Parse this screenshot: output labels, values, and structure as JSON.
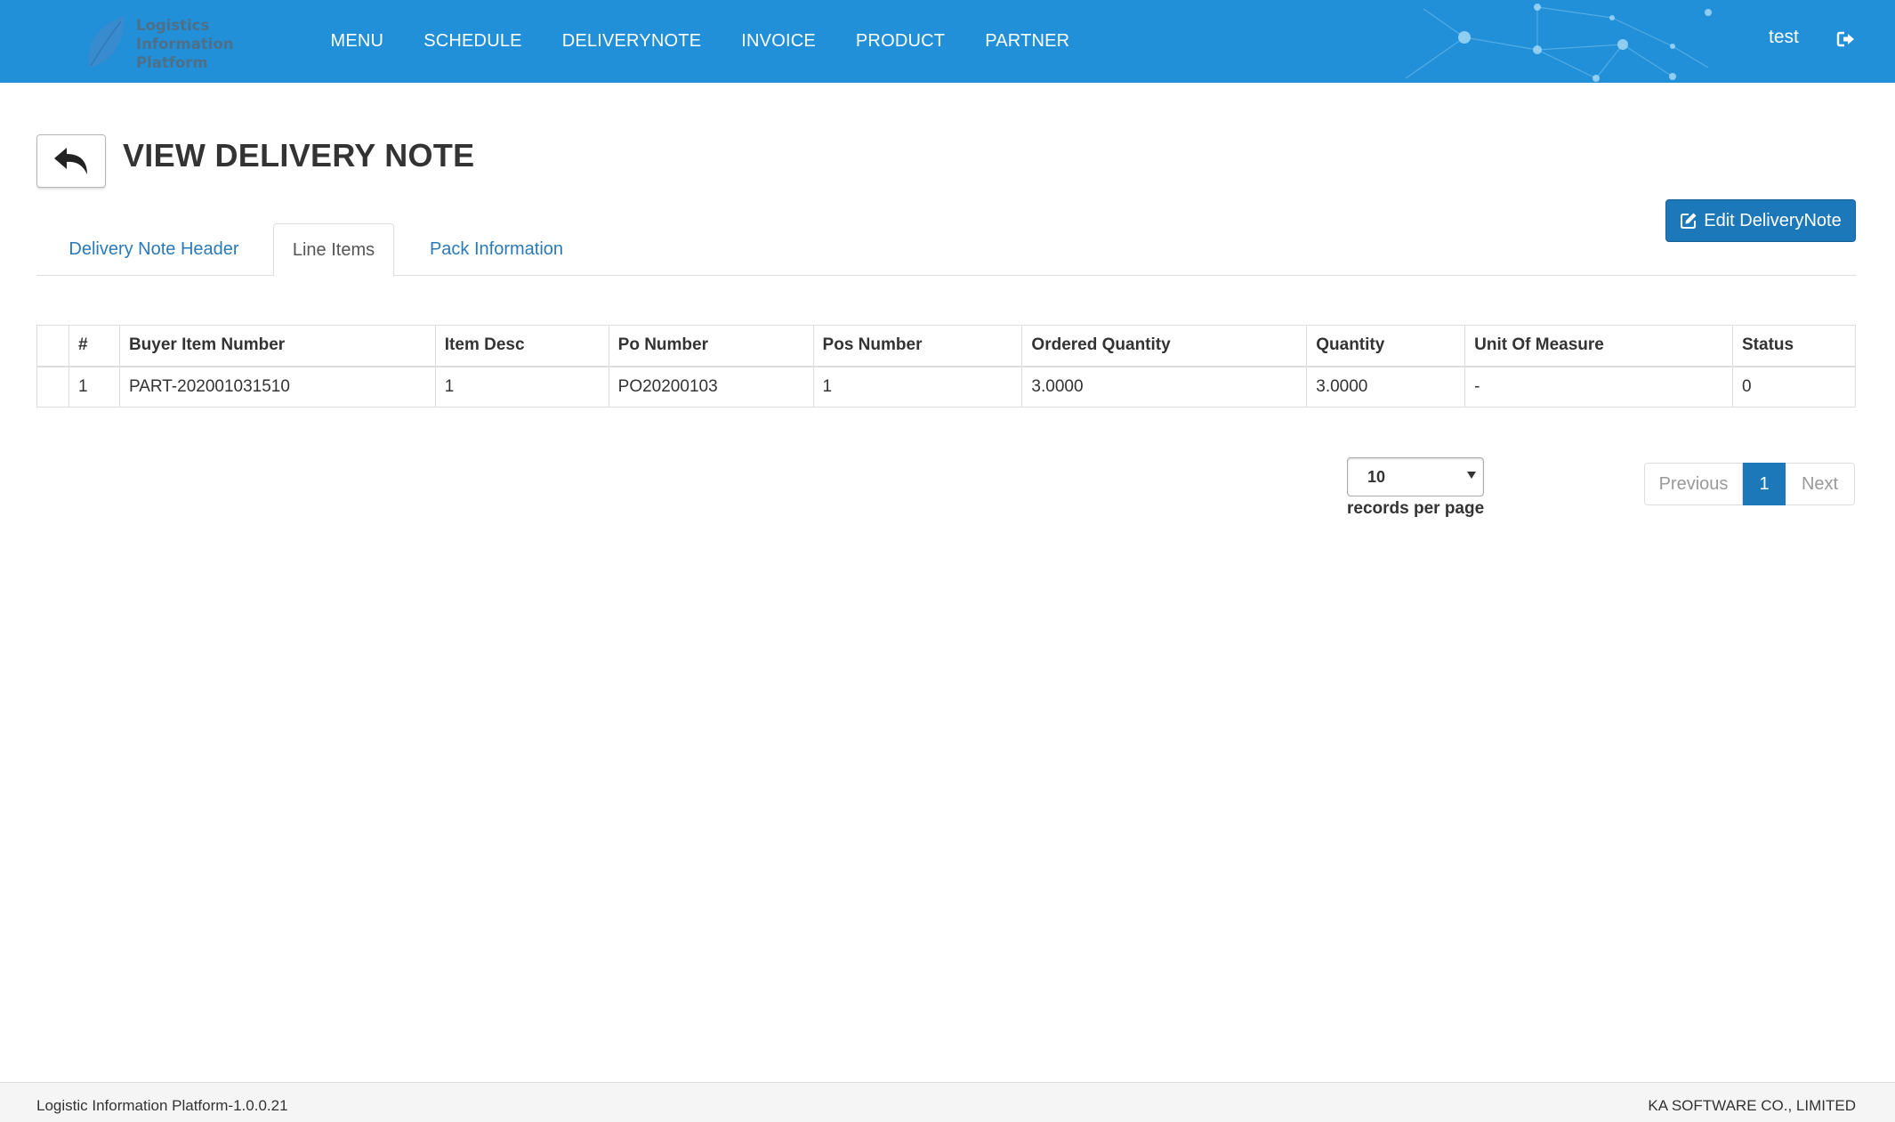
{
  "header": {
    "logo_lines": [
      "Logistics",
      "Information",
      "Platform"
    ],
    "nav": [
      "MENU",
      "SCHEDULE",
      "DELIVERYNOTE",
      "INVOICE",
      "PRODUCT",
      "PARTNER"
    ],
    "user": "test",
    "brand_color": "#2190d8"
  },
  "page": {
    "title": "VIEW DELIVERY NOTE",
    "edit_button": "Edit DeliveryNote",
    "tabs": [
      "Delivery Note Header",
      "Line Items",
      "Pack Information"
    ],
    "active_tab": "Line Items"
  },
  "table": {
    "columns": [
      "",
      "#",
      "Buyer Item Number",
      "Item Desc",
      "Po Number",
      "Pos Number",
      "Ordered Quantity",
      "Quantity",
      "Unit Of Measure",
      "Status"
    ],
    "rows": [
      [
        "",
        "1",
        "PART-202001031510",
        "1",
        "PO20200103",
        "1",
        "3.0000",
        "3.0000",
        "-",
        "0"
      ]
    ]
  },
  "pagination": {
    "page_size": "10",
    "records_label": "records per page",
    "previous": "Previous",
    "current": "1",
    "next": "Next"
  },
  "footer": {
    "version": "Logistic Information Platform-1.0.0.21",
    "company": "KA SOFTWARE CO., LIMITED"
  }
}
